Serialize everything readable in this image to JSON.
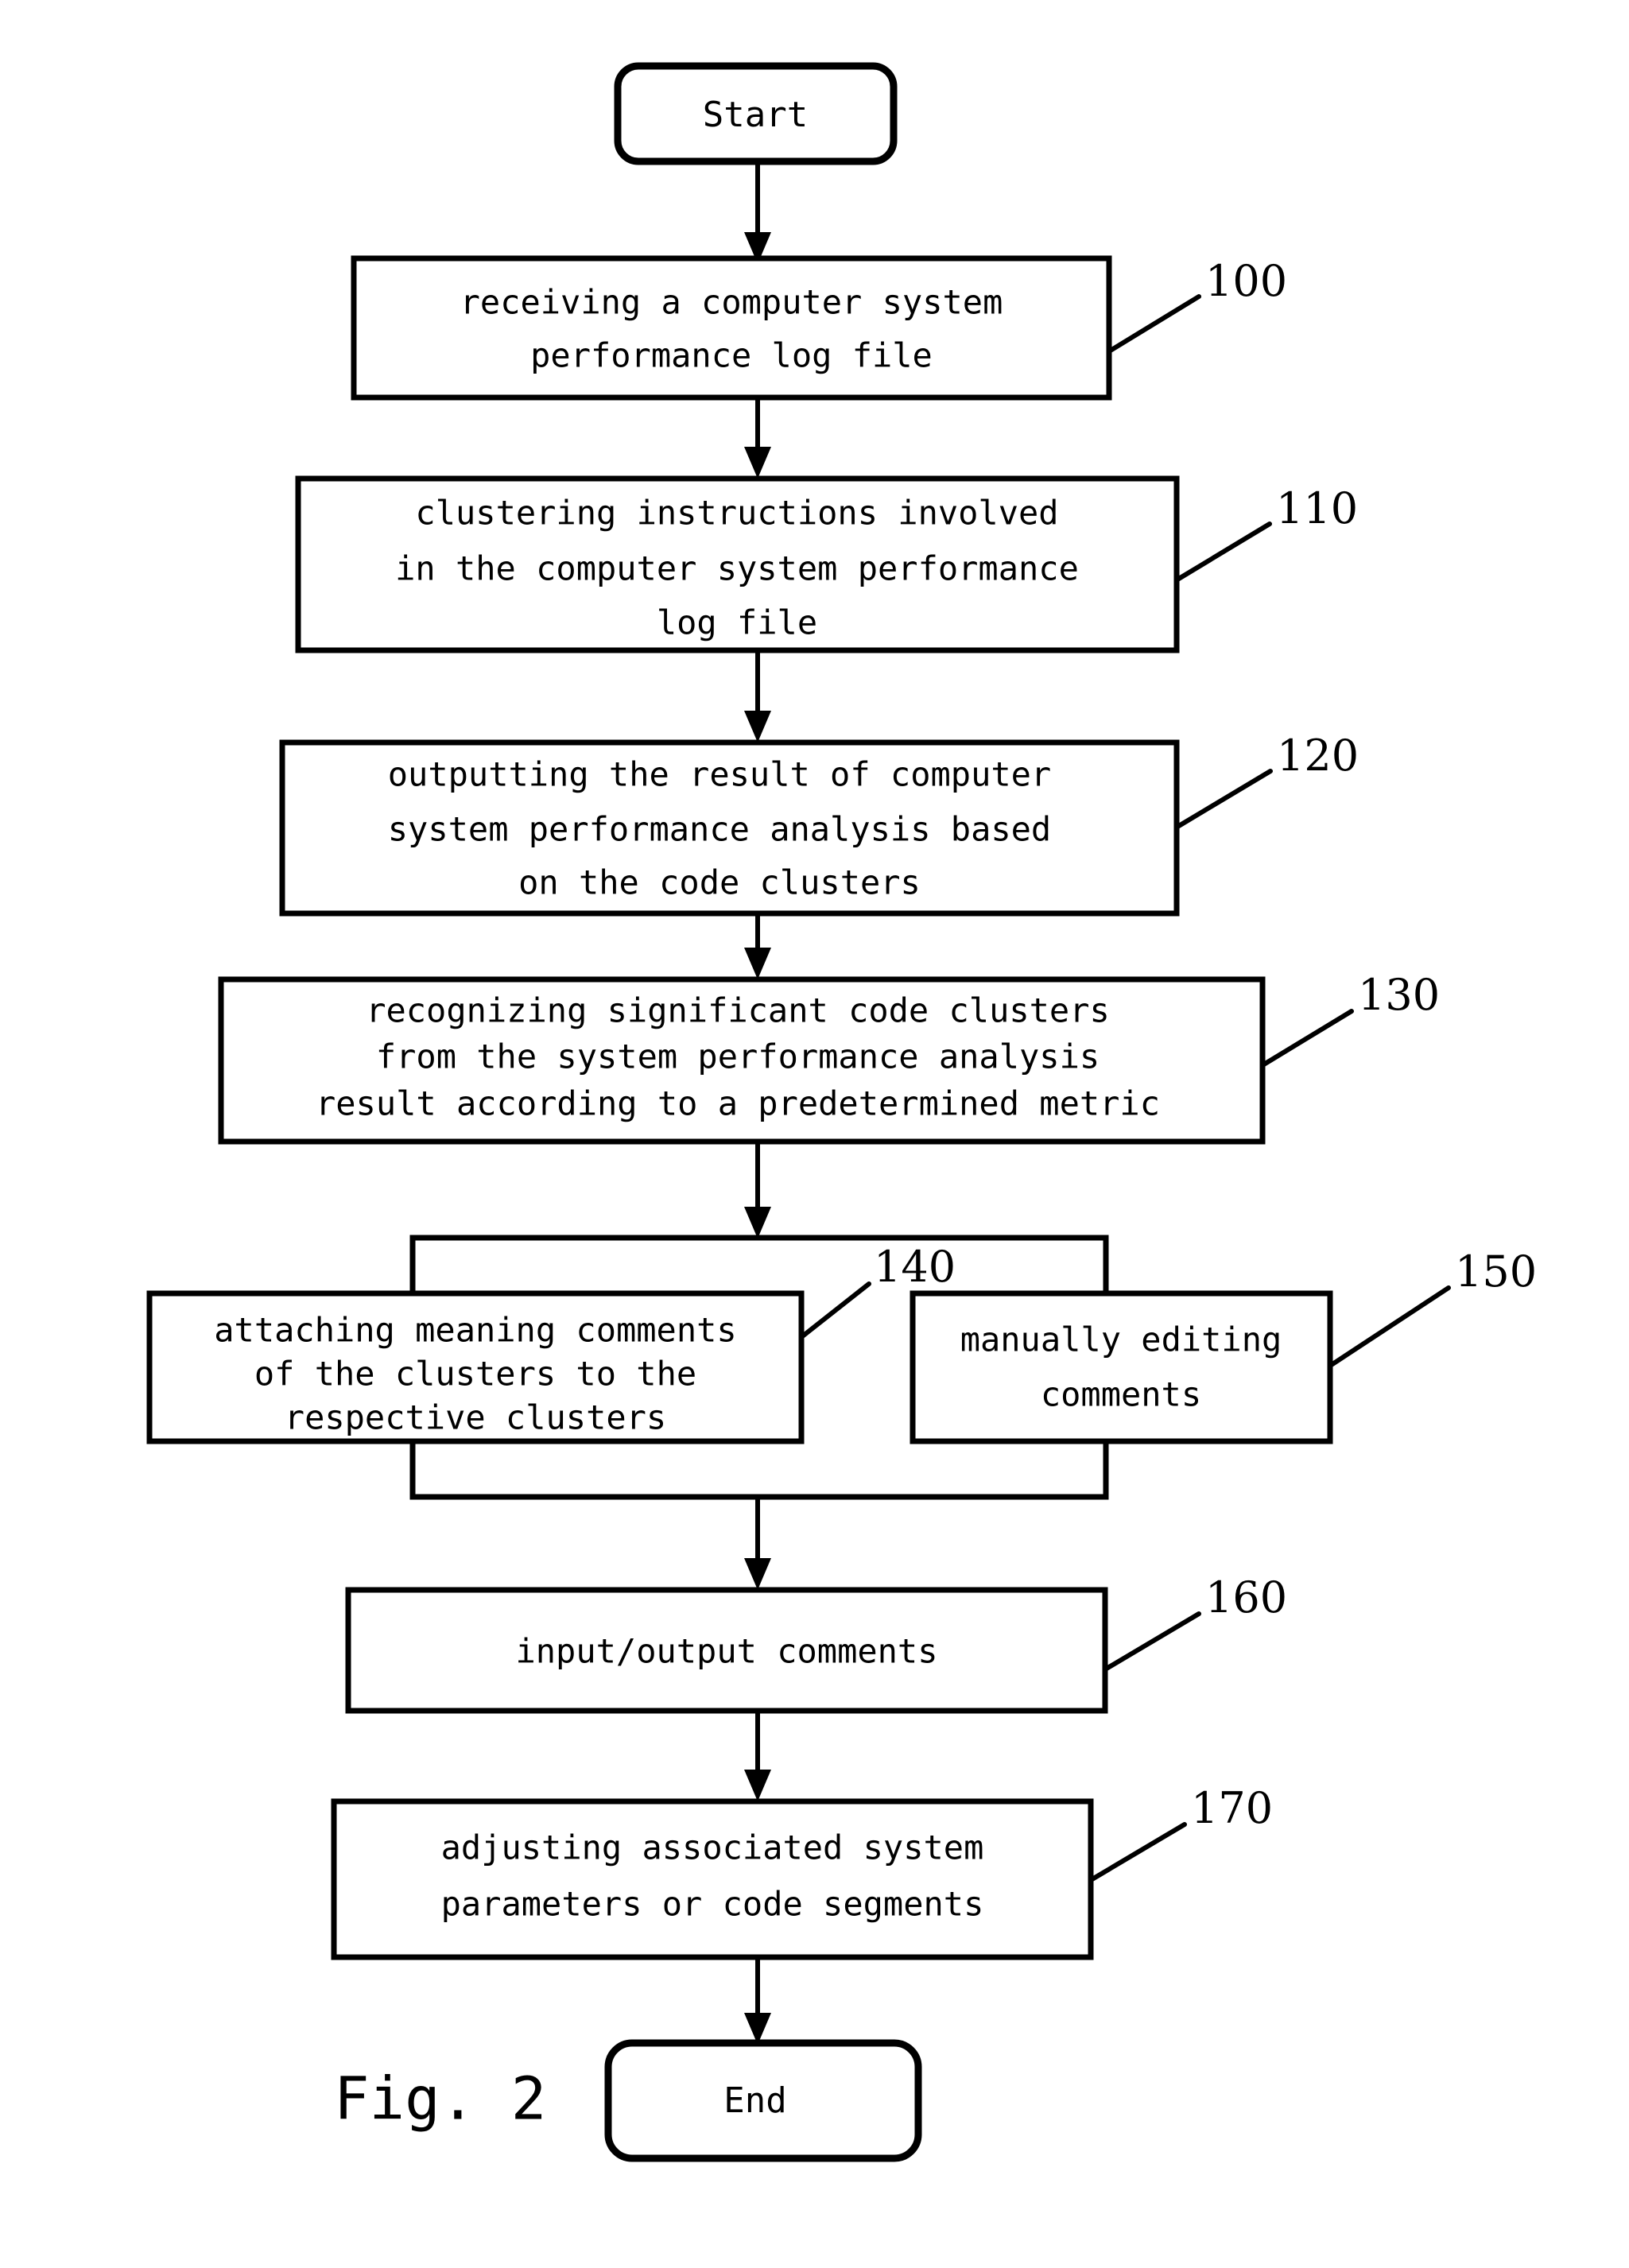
{
  "figure": {
    "caption": "Fig. 2",
    "start_label": "Start",
    "end_label": "End"
  },
  "nodes": [
    {
      "id": "start",
      "type": "terminator",
      "label": "Start",
      "ref": null
    },
    {
      "id": "step100",
      "type": "process",
      "ref": "100",
      "lines": [
        "receiving a computer system",
        "performance log file"
      ]
    },
    {
      "id": "step110",
      "type": "process",
      "ref": "110",
      "lines": [
        "clustering instructions involved",
        "in the computer system performance",
        "log file"
      ]
    },
    {
      "id": "step120",
      "type": "process",
      "ref": "120",
      "lines": [
        "outputting the result of computer",
        "system performance analysis based",
        "on the code clusters"
      ]
    },
    {
      "id": "step130",
      "type": "process",
      "ref": "130",
      "lines": [
        "recognizing significant code clusters",
        "from the system performance analysis",
        "result according to a predetermined metric"
      ]
    },
    {
      "id": "group140",
      "type": "group-container",
      "ref": null,
      "lines": []
    },
    {
      "id": "step140",
      "type": "process",
      "ref": "140",
      "lines": [
        "attaching meaning comments",
        "of the clusters to the",
        "respective clusters"
      ]
    },
    {
      "id": "step150",
      "type": "process",
      "ref": "150",
      "lines": [
        "manually editing",
        "comments"
      ]
    },
    {
      "id": "step160",
      "type": "process",
      "ref": "160",
      "lines": [
        "input/output comments"
      ]
    },
    {
      "id": "step170",
      "type": "process",
      "ref": "170",
      "lines": [
        "adjusting associated system",
        "parameters or code segments"
      ]
    },
    {
      "id": "end",
      "type": "terminator",
      "label": "End",
      "ref": null
    }
  ],
  "ref_numbers": {
    "n100": "100",
    "n110": "110",
    "n120": "120",
    "n130": "130",
    "n140": "140",
    "n150": "150",
    "n160": "160",
    "n170": "170"
  },
  "text": {
    "start": "Start",
    "end": "End",
    "caption": "Fig. 2",
    "s100_l1": "receiving a computer system",
    "s100_l2": "performance log file",
    "s110_l1": "clustering instructions involved",
    "s110_l2": "in the computer system performance",
    "s110_l3": "log file",
    "s120_l1": "outputting the result of computer",
    "s120_l2": "system performance analysis based",
    "s120_l3": "on the code clusters",
    "s130_l1": "recognizing significant code clusters",
    "s130_l2": "from the system performance analysis",
    "s130_l3": "result according to a predetermined metric",
    "s140_l1": "attaching meaning comments",
    "s140_l2": "of the clusters to the",
    "s140_l3": "respective clusters",
    "s150_l1": "manually editing",
    "s150_l2": "comments",
    "s160_l1": "input/output comments",
    "s170_l1": "adjusting associated system",
    "s170_l2": "parameters or code segments"
  },
  "colors": {
    "stroke": "#000000",
    "fill": "#ffffff",
    "background": "#ffffff"
  }
}
